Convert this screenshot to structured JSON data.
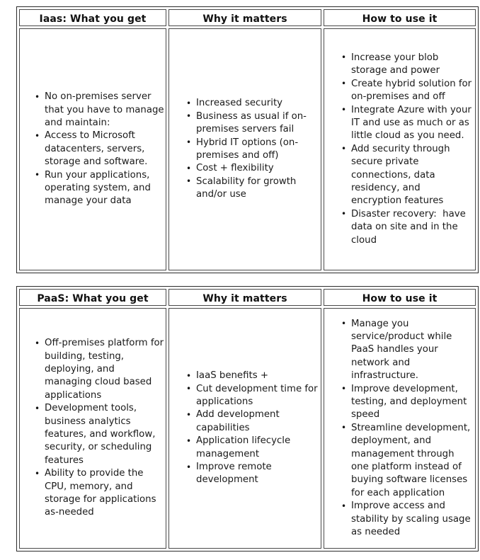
{
  "tables": [
    {
      "id": "iaas-table",
      "headers": [
        "Iaas: What you get",
        "Why it matters",
        "How to use it"
      ],
      "columns": [
        {
          "name": "what-you-get",
          "bullets": [
            "No on-premises server that you have to manage and maintain:",
            "Access to Microsoft datacenters, servers, storage and software.",
            "Run your applications, operating system, and manage your data"
          ]
        },
        {
          "name": "why-it-matters",
          "bullets": [
            "Increased security",
            "Business as usual if on-premises servers fail",
            "Hybrid IT options (on-premises and off)",
            "Cost + flexibility",
            "Scalability for growth and/or use"
          ]
        },
        {
          "name": "how-to-use-it",
          "bullets": [
            "Increase your blob storage and power",
            "Create hybrid solution for on-premises and off",
            "Integrate Azure with your IT and use as much or as little cloud as you need.",
            "Add security through secure private connections, data residency, and encryption features",
            "Disaster recovery:  have data on site and in the cloud"
          ]
        }
      ]
    },
    {
      "id": "paas-table",
      "headers": [
        "PaaS: What you get",
        "Why it matters",
        "How to use it"
      ],
      "columns": [
        {
          "name": "what-you-get",
          "bullets": [
            "Off-premises platform for building, testing, deploying, and managing cloud based applications",
            "Development tools, business analytics features, and workflow, security, or scheduling features",
            "Ability to provide the CPU, memory, and storage for applications as-needed"
          ]
        },
        {
          "name": "why-it-matters",
          "bullets": [
            "IaaS benefits +",
            "Cut development time for applications",
            "Add development capabilities",
            "Application lifecycle management",
            "Improve remote development"
          ]
        },
        {
          "name": "how-to-use-it",
          "bullets": [
            "Manage you service/product while PaaS handles your network and infrastructure.",
            "Improve development, testing, and deployment speed",
            "Streamline development, deployment, and management through one platform instead of buying software licenses for each application",
            "Improve access and stability by scaling usage as needed"
          ]
        }
      ]
    }
  ],
  "colors": {
    "text": "#1a1a1a",
    "border_outer": "#2b2b2b",
    "border_cell": "#4a4a4a",
    "background": "#ffffff"
  }
}
